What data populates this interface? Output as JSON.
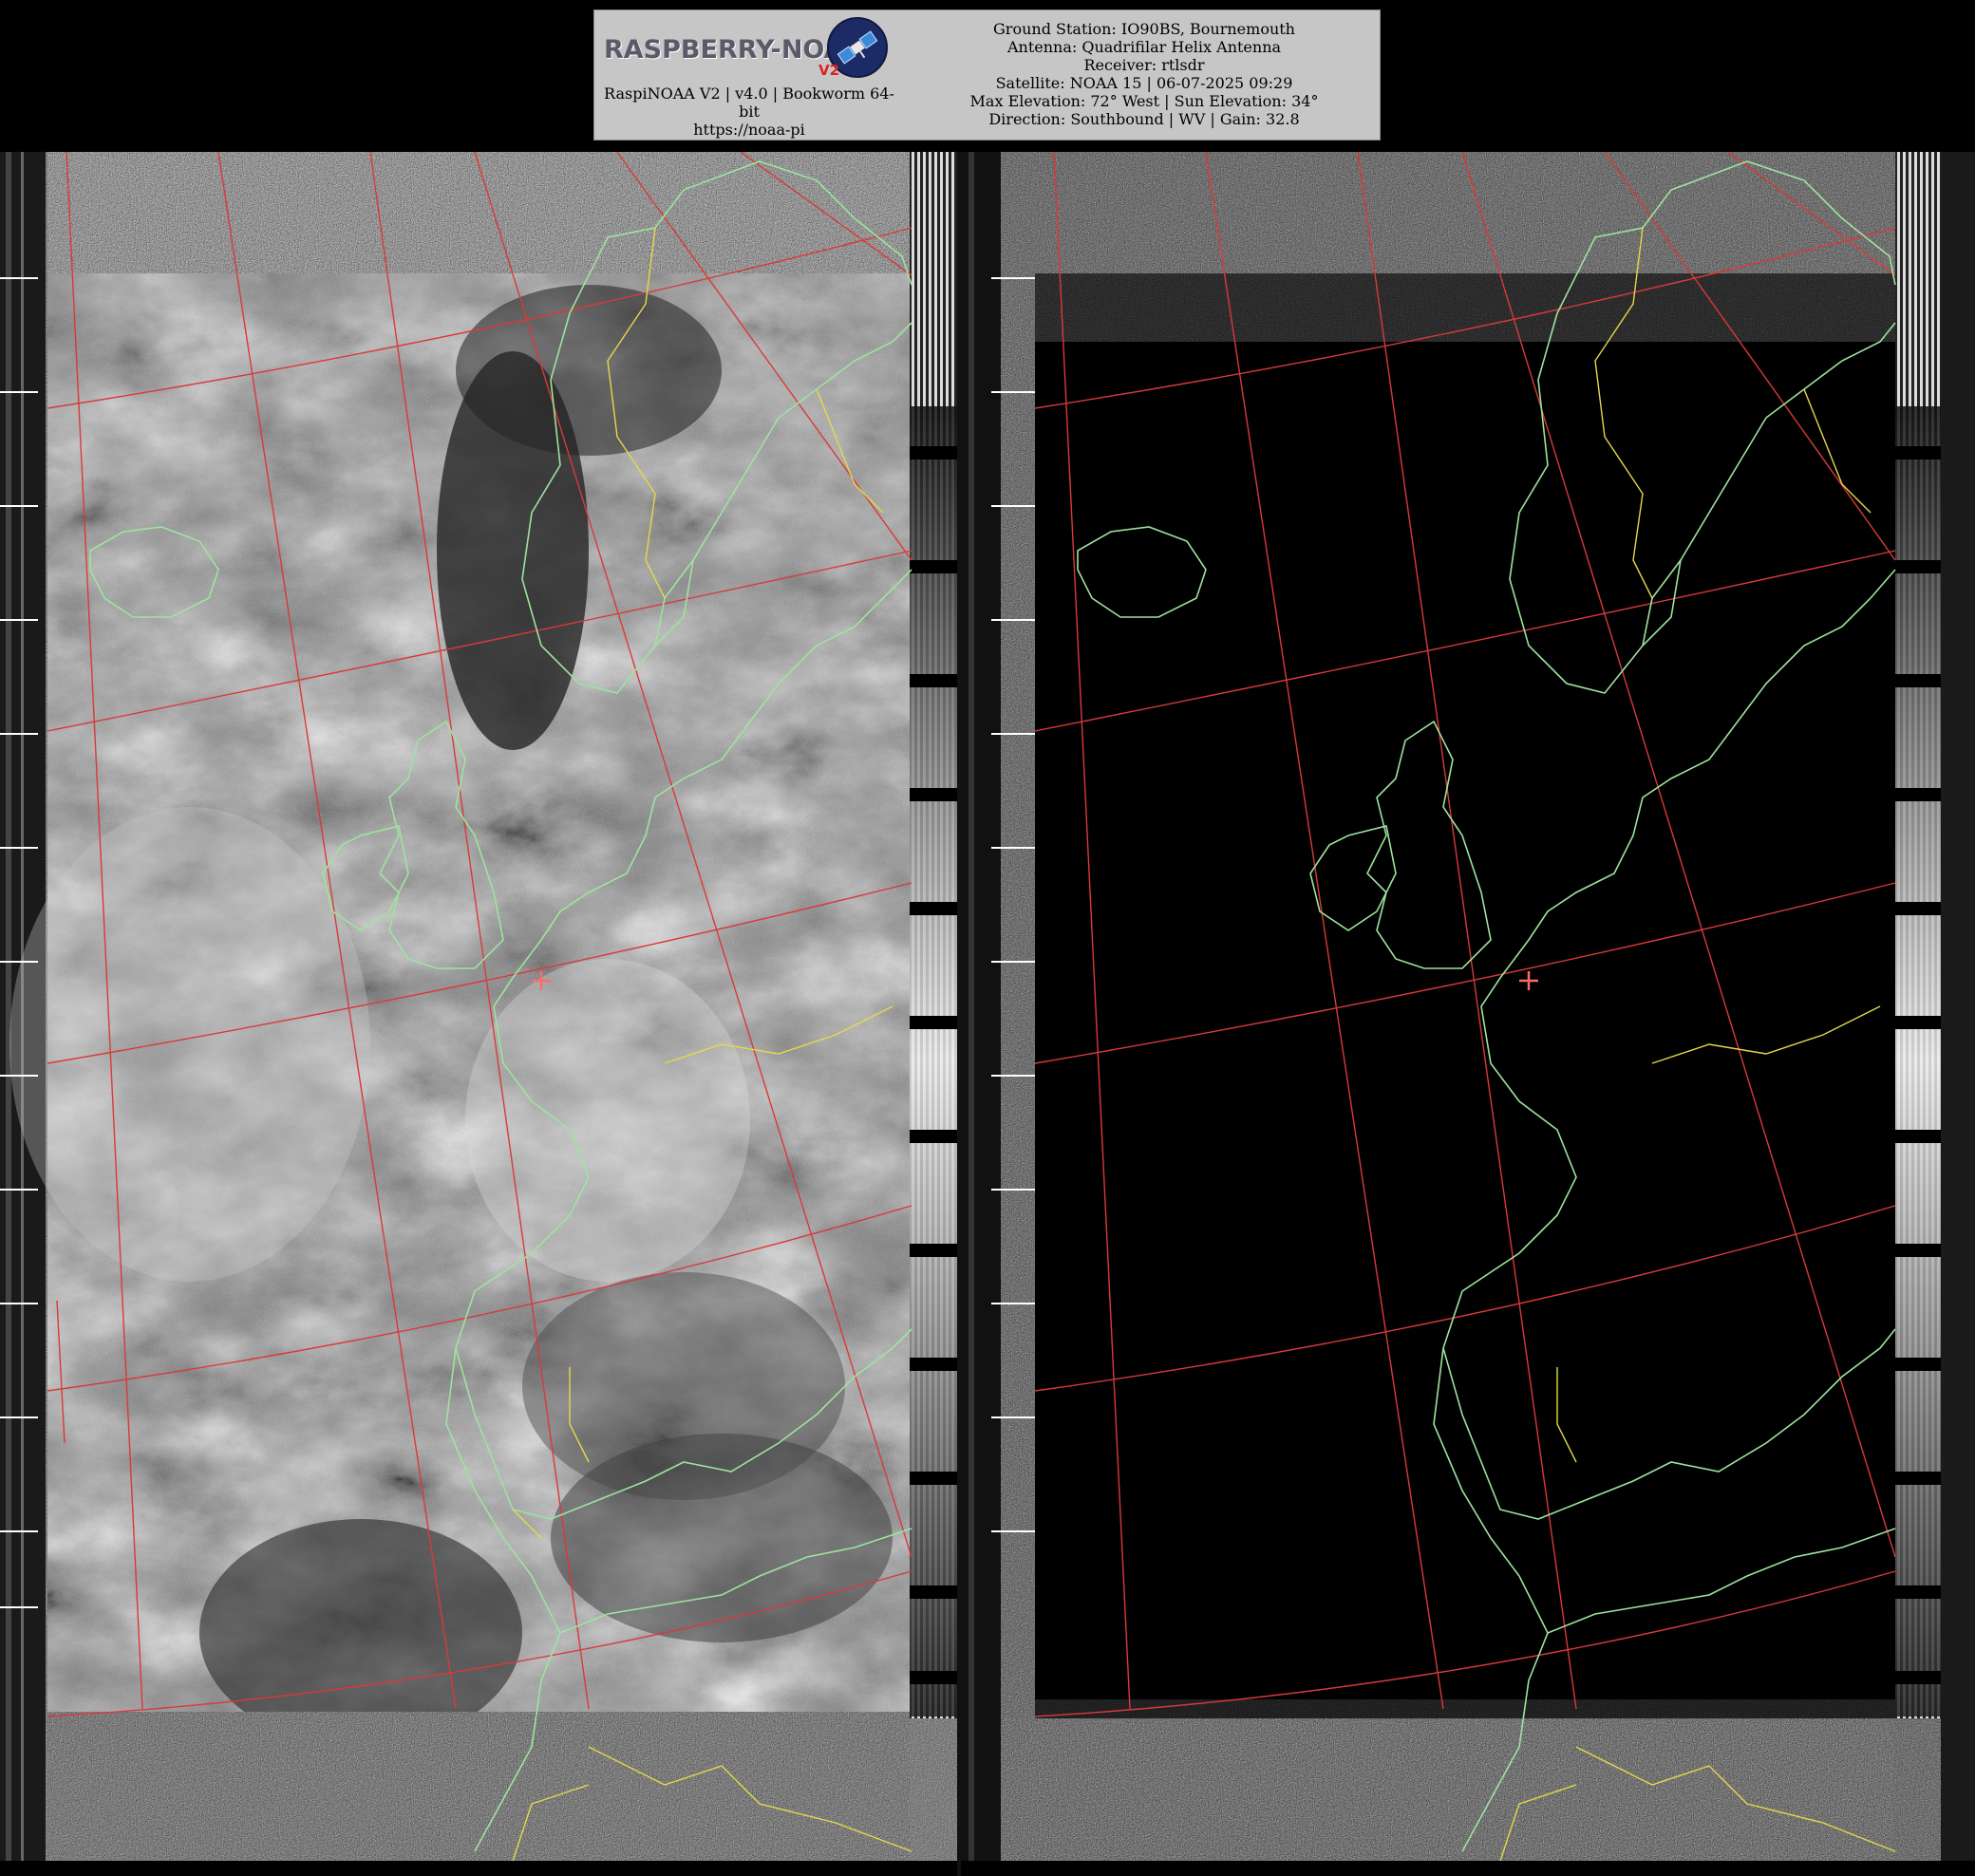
{
  "header": {
    "logo_text": "RASPBERRY-NOAA",
    "logo_version": "V2",
    "app_info_line1": "RaspiNOAA V2 | v4.0 | Bookworm 64-",
    "app_info_line2": "bit",
    "app_url": "https://noaa-pi",
    "station_lines": [
      "Ground Station: IO90BS, Bournemouth",
      "Antenna: Quadrifilar Helix Antenna",
      "Receiver: rtlsdr",
      "Satellite: NOAA 15 | 06-07-2025 09:29",
      "Max Elevation: 72° West | Sun Elevation: 34°",
      "Direction: Southbound | WV | Gain: 32.8"
    ]
  },
  "imagery": {
    "left_channel": "visible",
    "right_channel": "thermal-infrared",
    "overlay_colors": {
      "graticule": "#d83a3a",
      "coastline": "#9ee39e",
      "borders": "#e6d84a",
      "ground_station_marker": "#ff6a6a"
    }
  }
}
